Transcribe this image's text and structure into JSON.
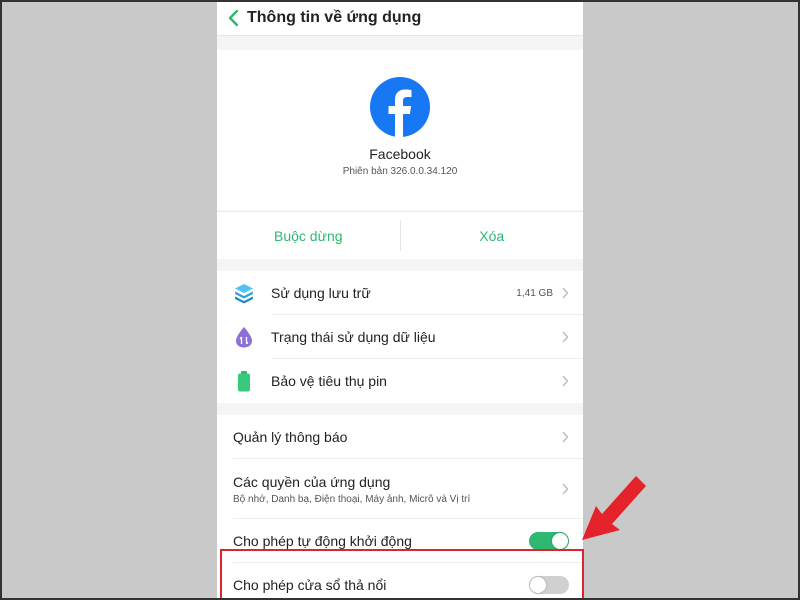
{
  "header": {
    "title": "Thông tin về ứng dụng",
    "back_icon": "chevron-left-icon"
  },
  "app": {
    "name": "Facebook",
    "version": "Phiên bản 326.0.0.34.120",
    "logo_color": "#1877f2"
  },
  "actions": {
    "force_stop": "Buộc dừng",
    "delete": "Xóa",
    "accent": "#2eb872"
  },
  "group1": [
    {
      "label": "Sử dụng lưu trữ",
      "value": "1,41 GB",
      "icon": "storage-icon"
    },
    {
      "label": "Trạng thái sử dụng dữ liệu",
      "icon": "data-usage-icon"
    },
    {
      "label": "Bảo vệ tiêu thụ pin",
      "icon": "battery-icon"
    }
  ],
  "group2": {
    "notifications": "Quản lý thông báo",
    "permissions": {
      "label": "Các quyền của ứng dụng",
      "sub": "Bộ nhớ, Danh bạ, Điện thoại, Máy ảnh, Micrô và Vị trí"
    },
    "auto_start": {
      "label": "Cho phép tự động khởi động",
      "enabled": true
    },
    "floating": {
      "label": "Cho phép cửa sổ thả nổi",
      "enabled": false
    }
  },
  "annotation": {
    "highlight_color": "#d9272e"
  }
}
